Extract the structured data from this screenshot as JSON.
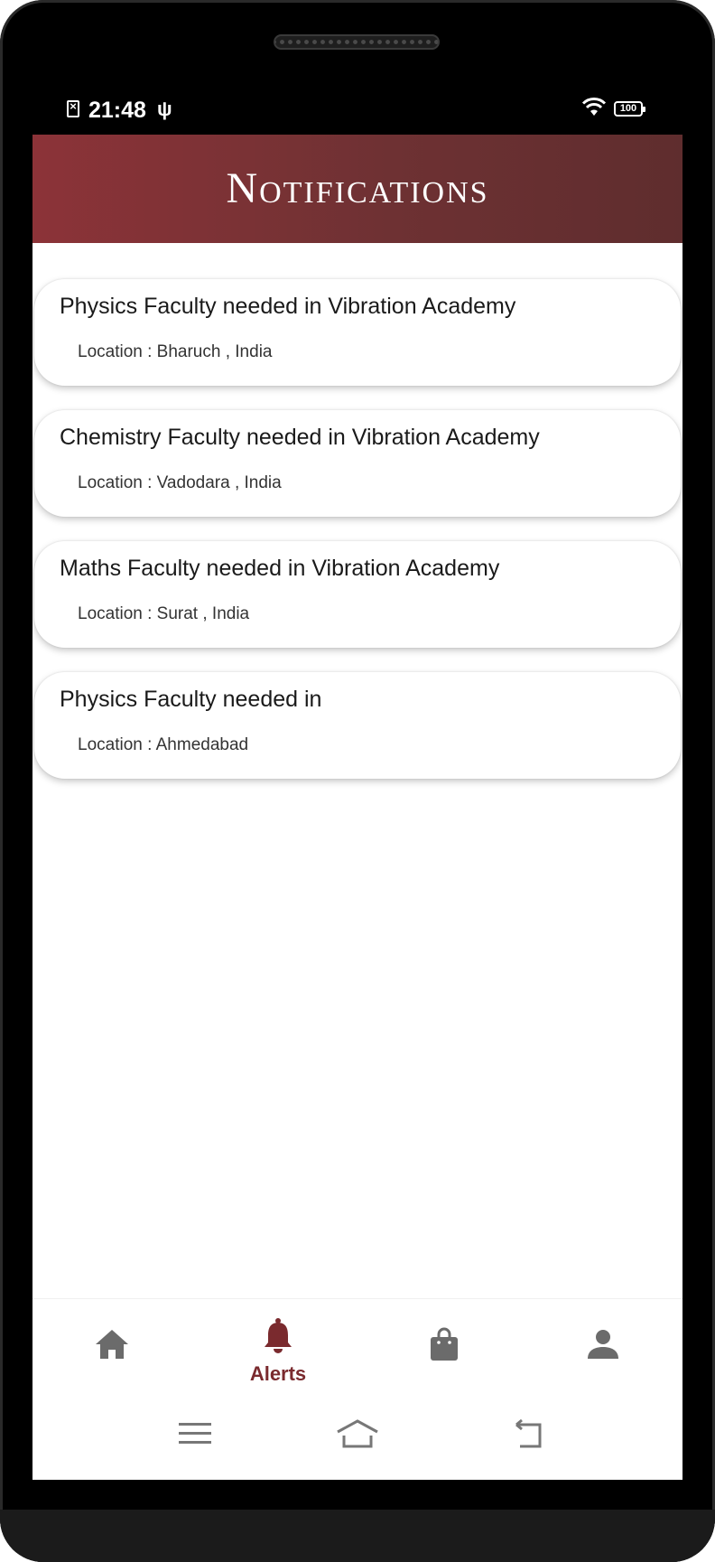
{
  "status_bar": {
    "time": "21:48",
    "battery": "100",
    "icons": [
      "sim-error-icon",
      "usb-icon",
      "wifi-icon",
      "battery-icon"
    ]
  },
  "app_bar": {
    "title": "Notifications",
    "gradient_colors": [
      "#8c3338",
      "#5f2d2e"
    ]
  },
  "notifications": [
    {
      "title": "Physics Faculty needed in Vibration Academy",
      "location": "Location : Bharuch , India"
    },
    {
      "title": "Chemistry Faculty needed in Vibration Academy",
      "location": "Location : Vadodara , India"
    },
    {
      "title": "Maths Faculty needed in Vibration Academy",
      "location": "Location : Surat , India"
    },
    {
      "title": "Physics Faculty needed in",
      "location": "Location : Ahmedabad"
    }
  ],
  "bottom_nav": {
    "active_color": "#7a2a2e",
    "inactive_color": "#6b6b6b",
    "items": [
      {
        "icon": "home-icon",
        "label": "",
        "active": false
      },
      {
        "icon": "bell-icon",
        "label": "Alerts",
        "active": true
      },
      {
        "icon": "shopping-bag-icon",
        "label": "",
        "active": false
      },
      {
        "icon": "person-icon",
        "label": "",
        "active": false
      }
    ]
  },
  "system_nav": {
    "icons": [
      "menu-icon",
      "home-outline-icon",
      "back-icon"
    ]
  }
}
